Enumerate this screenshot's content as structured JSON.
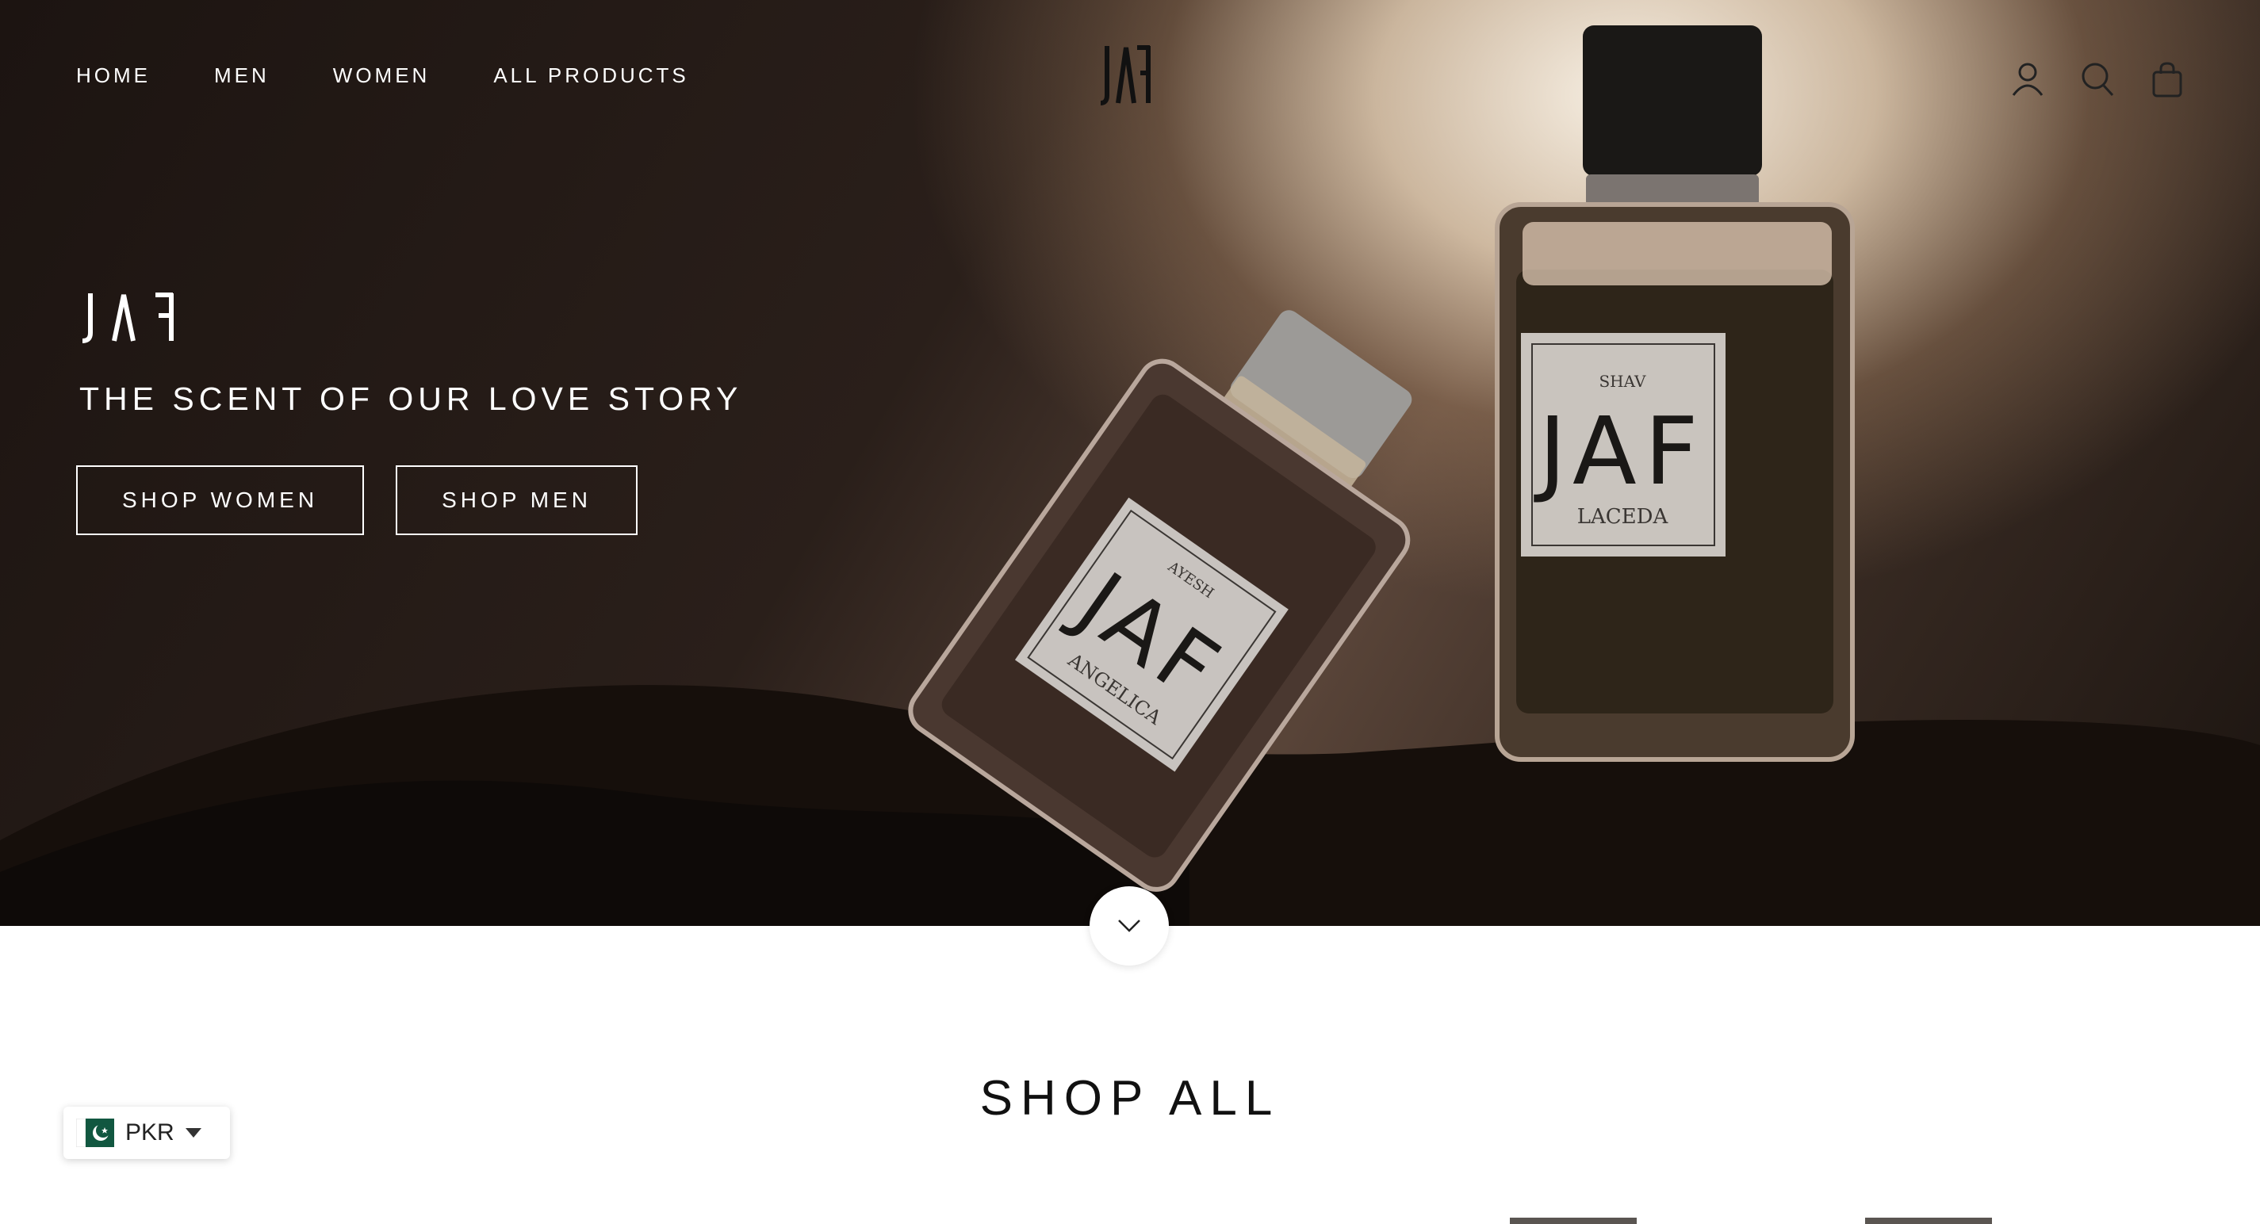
{
  "colors": {
    "accent": "#ffffff",
    "text": "#111111",
    "hero_dark": "#1c1411",
    "flag_green": "#115740"
  },
  "nav": {
    "items": [
      {
        "label": "HOME"
      },
      {
        "label": "MEN"
      },
      {
        "label": "WOMEN"
      },
      {
        "label": "ALL PRODUCTS"
      }
    ]
  },
  "brand": {
    "logo": "JAF"
  },
  "header_icons": [
    "account-icon",
    "search-icon",
    "bag-icon"
  ],
  "hero": {
    "tagline": "THE SCENT OF OUR LOVE STORY",
    "buttons": {
      "shop_women": "SHOP WOMEN",
      "shop_men": "SHOP MEN"
    },
    "bottle_left": {
      "name": "AYESH",
      "variant": "ANGELICA"
    },
    "bottle_right": {
      "name": "SHAV",
      "variant": "LACEDA"
    }
  },
  "section": {
    "title": "SHOP ALL"
  },
  "currency": {
    "code": "PKR",
    "flag": "pakistan-flag-icon"
  }
}
